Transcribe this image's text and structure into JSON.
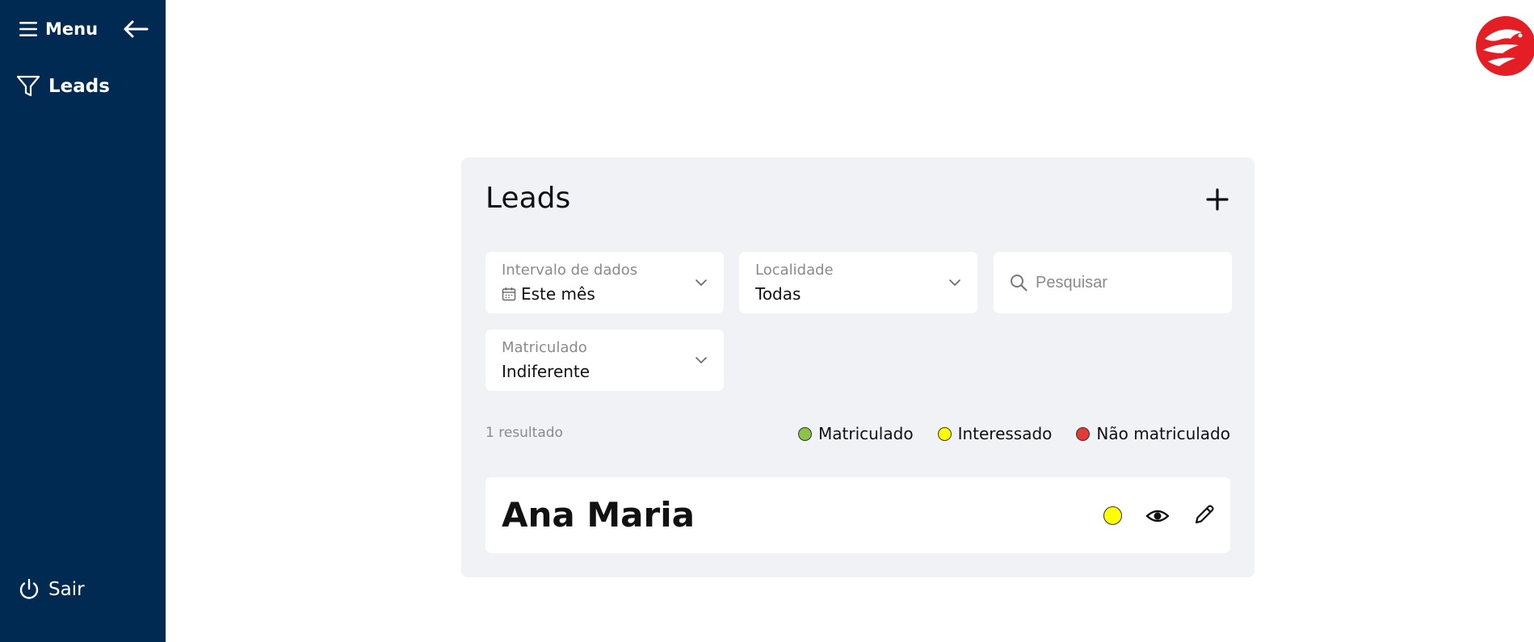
{
  "sidebar": {
    "menu_label": "Menu",
    "nav_items": [
      {
        "label": "Leads",
        "icon": "filter-icon"
      }
    ],
    "logout_label": "Sair"
  },
  "colors": {
    "sidebar_bg": "#012a52",
    "brand_red": "#e31e24",
    "card_bg": "#f1f2f6",
    "matriculado": "#8bc34a",
    "interessado": "#ffff00",
    "nao_matriculado": "#e53935"
  },
  "page": {
    "title": "Leads",
    "filters": {
      "date_range": {
        "label": "Intervalo de dados",
        "value": "Este mês"
      },
      "location": {
        "label": "Localidade",
        "value": "Todas"
      },
      "enrolled": {
        "label": "Matriculado",
        "value": "Indiferente"
      }
    },
    "search": {
      "placeholder": "Pesquisar"
    },
    "result_count": "1 resultado",
    "legend": [
      {
        "label": "Matriculado",
        "color": "#8bc34a"
      },
      {
        "label": "Interessado",
        "color": "#ffff00"
      },
      {
        "label": "Não matriculado",
        "color": "#e53935"
      }
    ],
    "leads": [
      {
        "name": "Ana Maria",
        "status": "Interessado",
        "status_color": "#ffff00"
      }
    ]
  }
}
